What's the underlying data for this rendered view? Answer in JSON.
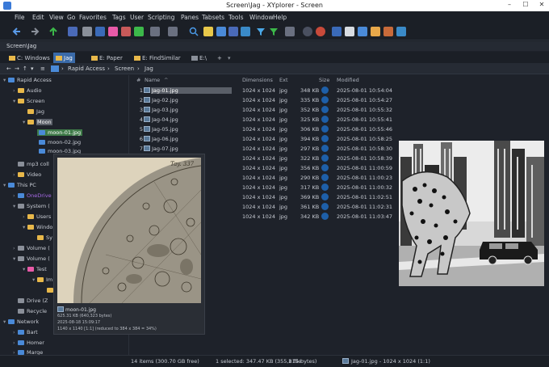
{
  "window": {
    "title": "Screen\\Jag - XYplorer - Screen"
  },
  "menu": [
    "File",
    "Edit",
    "View",
    "Go",
    "Favorites",
    "Tags",
    "User",
    "Scripting",
    "Panes",
    "Tabsets",
    "Tools",
    "Window",
    "Help"
  ],
  "address": "Screen\\Jag",
  "tabs": [
    {
      "label": "C: Windows",
      "active": false
    },
    {
      "label": "Jag",
      "active": true
    },
    {
      "label": "E: Paper",
      "active": false
    },
    {
      "label": "E: FindSimilar",
      "active": false
    },
    {
      "label": "E:\\",
      "active": false
    },
    {
      "label": "+",
      "active": false
    }
  ],
  "breadcrumb": [
    "Rapid Access",
    "Screen",
    "Jag"
  ],
  "tree": [
    {
      "label": "Rapid Access",
      "arrow": "▾",
      "icon": "blue"
    },
    {
      "label": "Audio",
      "arrow": "›",
      "icon": "folder"
    },
    {
      "label": "Screen",
      "arrow": "▾",
      "icon": "folder"
    },
    {
      "label": "Jag",
      "arrow": "",
      "icon": "folder"
    },
    {
      "label": "Moon",
      "arrow": "▾",
      "icon": "folder"
    },
    {
      "label": "moon-01.jpg",
      "arrow": "",
      "icon": "file"
    },
    {
      "label": "moon-02.jpg",
      "arrow": "",
      "icon": "file"
    },
    {
      "label": "moon-03.jpg",
      "arrow": "",
      "icon": "file"
    },
    {
      "label": "mp3 coll",
      "arrow": "",
      "icon": "gray"
    },
    {
      "label": "Video",
      "arrow": "›",
      "icon": "folder"
    },
    {
      "label": "This PC",
      "arrow": "▾",
      "icon": "blue"
    },
    {
      "label": "OneDrive",
      "arrow": "›",
      "icon": "blue"
    },
    {
      "label": "System (",
      "arrow": "▾",
      "icon": "gray"
    },
    {
      "label": "Users",
      "arrow": "›",
      "icon": "folder"
    },
    {
      "label": "Windo",
      "arrow": "▾",
      "icon": "folder"
    },
    {
      "label": "Sy",
      "arrow": "",
      "icon": "folder"
    },
    {
      "label": "Volume (",
      "arrow": "›",
      "icon": "gray"
    },
    {
      "label": "Volume (",
      "arrow": "▾",
      "icon": "gray"
    },
    {
      "label": "Test",
      "arrow": "▾",
      "icon": "folder"
    },
    {
      "label": "Im",
      "arrow": "▾",
      "icon": "folder"
    },
    {
      "label": "",
      "arrow": "",
      "icon": "folder"
    },
    {
      "label": "Drive (Z",
      "arrow": "",
      "icon": "gray"
    },
    {
      "label": "Recycle",
      "arrow": "",
      "icon": "gray"
    },
    {
      "label": "Network",
      "arrow": "▾",
      "icon": "blue"
    },
    {
      "label": "Bart",
      "arrow": "›",
      "icon": "blue"
    },
    {
      "label": "Homer",
      "arrow": "›",
      "icon": "blue"
    },
    {
      "label": "Marge",
      "arrow": "›",
      "icon": "blue"
    }
  ],
  "list": {
    "columns": {
      "num": "#",
      "name": "Name",
      "dimensions": "Dimensions",
      "ext": "Ext",
      "size": "Size",
      "modified": "Modified"
    },
    "rows": [
      {
        "num": "1",
        "name": "Jag-01.jpg",
        "dim": "1024 x 1024",
        "ext": "jpg",
        "size": "348 KB",
        "mod": "2025-08-01 10:54:04"
      },
      {
        "num": "2",
        "name": "Jag-02.jpg",
        "dim": "1024 x 1024",
        "ext": "jpg",
        "size": "335 KB",
        "mod": "2025-08-01 10:54:27"
      },
      {
        "num": "3",
        "name": "Jag-03.jpg",
        "dim": "1024 x 1024",
        "ext": "jpg",
        "size": "352 KB",
        "mod": "2025-08-01 10:55:32"
      },
      {
        "num": "4",
        "name": "Jag-04.jpg",
        "dim": "1024 x 1024",
        "ext": "jpg",
        "size": "325 KB",
        "mod": "2025-08-01 10:55:41"
      },
      {
        "num": "5",
        "name": "Jag-05.jpg",
        "dim": "1024 x 1024",
        "ext": "jpg",
        "size": "306 KB",
        "mod": "2025-08-01 10:55:46"
      },
      {
        "num": "6",
        "name": "Jag-06.jpg",
        "dim": "1024 x 1024",
        "ext": "jpg",
        "size": "394 KB",
        "mod": "2025-08-01 10:58:25"
      },
      {
        "num": "7",
        "name": "Jag-07.jpg",
        "dim": "1024 x 1024",
        "ext": "jpg",
        "size": "297 KB",
        "mod": "2025-08-01 10:58:30"
      },
      {
        "num": "8",
        "name": "",
        "dim": "1024 x 1024",
        "ext": "jpg",
        "size": "322 KB",
        "mod": "2025-08-01 10:58:39"
      },
      {
        "num": "9",
        "name": "",
        "dim": "1024 x 1024",
        "ext": "jpg",
        "size": "356 KB",
        "mod": "2025-08-01 11:00:59"
      },
      {
        "num": "10",
        "name": "",
        "dim": "1024 x 1024",
        "ext": "jpg",
        "size": "290 KB",
        "mod": "2025-08-01 11:00:23"
      },
      {
        "num": "11",
        "name": "",
        "dim": "1024 x 1024",
        "ext": "jpg",
        "size": "317 KB",
        "mod": "2025-08-01 11:00:32"
      },
      {
        "num": "12",
        "name": "",
        "dim": "1024 x 1024",
        "ext": "jpg",
        "size": "369 KB",
        "mod": "2025-08-01 11:02:51"
      },
      {
        "num": "13",
        "name": "",
        "dim": "1024 x 1024",
        "ext": "jpg",
        "size": "361 KB",
        "mod": "2025-08-01 11:02:31"
      },
      {
        "num": "14",
        "name": "",
        "dim": "1024 x 1024",
        "ext": "jpg",
        "size": "342 KB",
        "mod": "2025-08-01 11:03:47"
      }
    ]
  },
  "tooltip": {
    "name": "moon-01.jpg",
    "line2": "625.31 KB (640,323 bytes)",
    "line3": "2025-08-18 15:09:17",
    "line4": "1140 x 1140 [1:1] (reduced to 384 x 384 = 34%)",
    "plate_label": "Tay. 337"
  },
  "status": {
    "items": "14 items (300.70 GB free)",
    "selected": "1 selected: 347.47 KB (355,815 bytes)",
    "files": "1 file",
    "current": "Jag-01.jpg - 1024 x 1024 (1:1)"
  }
}
